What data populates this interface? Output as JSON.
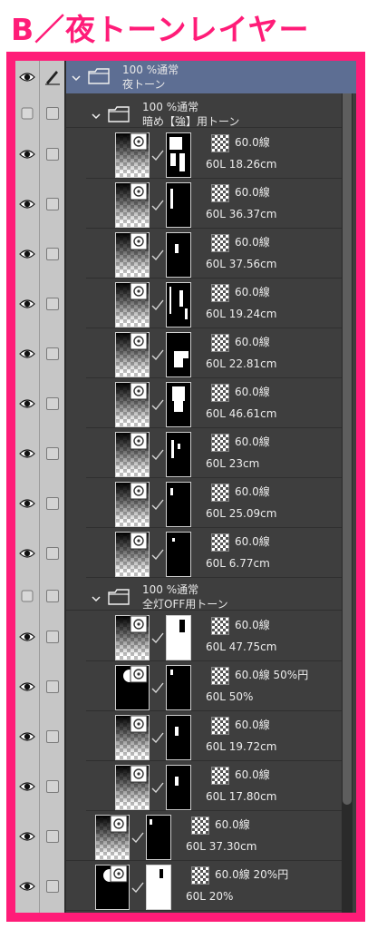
{
  "title": "B／夜トーンレイヤー",
  "group_main": {
    "blend": "100 %通常",
    "name": "夜トーン"
  },
  "group_dark": {
    "blend": "100 %通常",
    "name": "暗め【強】用トーン"
  },
  "group_off": {
    "blend": "100 %通常",
    "name": "全灯OFF用トーン"
  },
  "layers": [
    {
      "tone": "60.0線",
      "info": "60L 18.26cm"
    },
    {
      "tone": "60.0線",
      "info": "60L 36.37cm"
    },
    {
      "tone": "60.0線",
      "info": "60L 37.56cm"
    },
    {
      "tone": "60.0線",
      "info": "60L 19.24cm"
    },
    {
      "tone": "60.0線",
      "info": "60L 22.81cm"
    },
    {
      "tone": "60.0線",
      "info": "60L 46.61cm"
    },
    {
      "tone": "60.0線",
      "info": "60L 23cm"
    },
    {
      "tone": "60.0線",
      "info": "60L 25.09cm"
    },
    {
      "tone": "60.0線",
      "info": "60L 6.77cm"
    },
    {
      "tone": "60.0線",
      "info": "60L 47.75cm"
    },
    {
      "tone": "60.0線 50%円",
      "info": "60L 50%"
    },
    {
      "tone": "60.0線",
      "info": "60L 19.72cm"
    },
    {
      "tone": "60.0線",
      "info": "60L 17.80cm"
    },
    {
      "tone": "60.0線",
      "info": "60L 37.30cm"
    },
    {
      "tone": "60.0線 20%円",
      "info": "60L 20%"
    }
  ]
}
